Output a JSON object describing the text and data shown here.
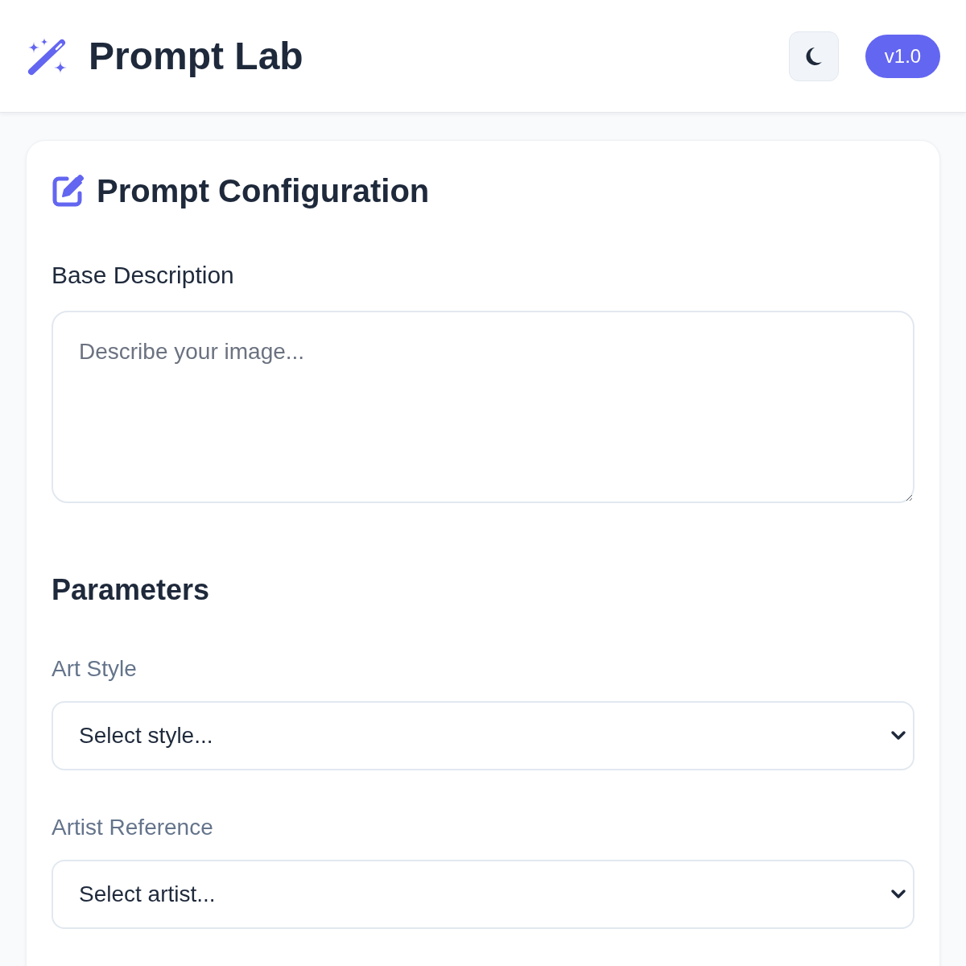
{
  "header": {
    "title": "Prompt Lab",
    "version_badge": "v1.0"
  },
  "config_card": {
    "title": "Prompt Configuration",
    "base_description": {
      "label": "Base Description",
      "placeholder": "Describe your image..."
    },
    "parameters": {
      "heading": "Parameters",
      "fields": [
        {
          "label": "Art Style",
          "value": "Select style..."
        },
        {
          "label": "Artist Reference",
          "value": "Select artist..."
        }
      ]
    }
  }
}
